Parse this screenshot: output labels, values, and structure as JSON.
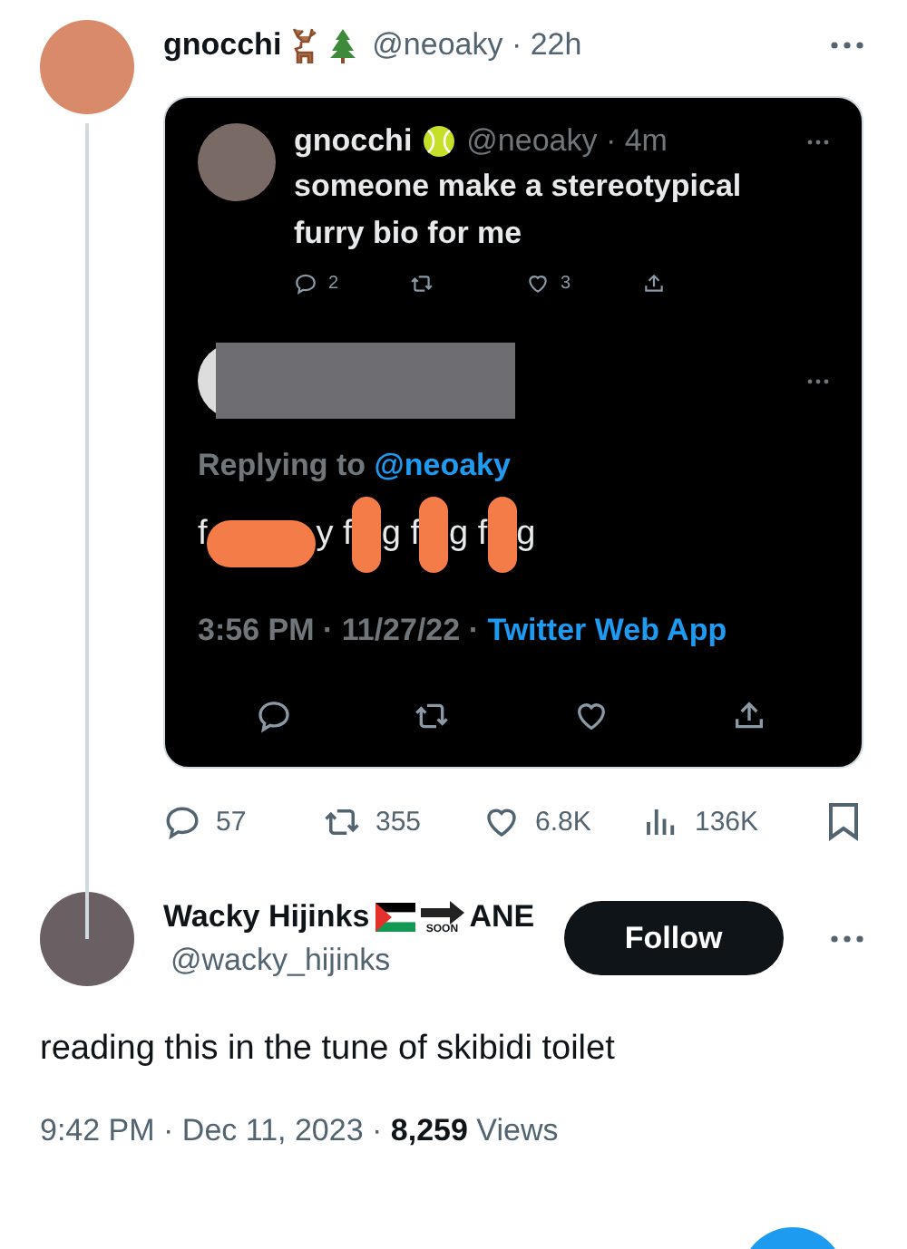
{
  "tweet": {
    "name": "gnocchi",
    "byline": "@neoaky · 22h",
    "stats": [
      {
        "kind": "reply",
        "count": "57"
      },
      {
        "kind": "retweet",
        "count": "355"
      },
      {
        "kind": "like",
        "count": "6.8K"
      },
      {
        "kind": "views",
        "count": "136K"
      }
    ]
  },
  "screenshot": {
    "tweet": {
      "name": "gnocchi",
      "byline": "@neoaky · 4m",
      "text": "someone make a stereotypical furry bio for me",
      "stats": [
        {
          "kind": "reply",
          "count": "2"
        },
        {
          "kind": "retweet"
        },
        {
          "kind": "like",
          "count": "3"
        },
        {
          "kind": "share"
        }
      ]
    },
    "reply": {
      "replying_label": "Replying to",
      "replying_handle": "@neoaky",
      "text_parts": [
        "f",
        "y f",
        "g f",
        "g f",
        "g"
      ],
      "timestamp": "3:56 PM · 11/27/22 ·",
      "source": "Twitter Web App",
      "actions": [
        {
          "kind": "reply"
        },
        {
          "kind": "retweet"
        },
        {
          "kind": "like"
        },
        {
          "kind": "share"
        }
      ]
    }
  },
  "reply": {
    "name": "Wacky Hijinks",
    "badge_text": "SOON",
    "name_suffix": "ANE",
    "handle": "@wacky_hijinks",
    "follow_label": "Follow",
    "text": "reading this in the tune of skibidi toilet",
    "timestamp": "9:42 PM · Dec 11, 2023 ·",
    "views_count": "8,259",
    "views_label": "Views"
  }
}
